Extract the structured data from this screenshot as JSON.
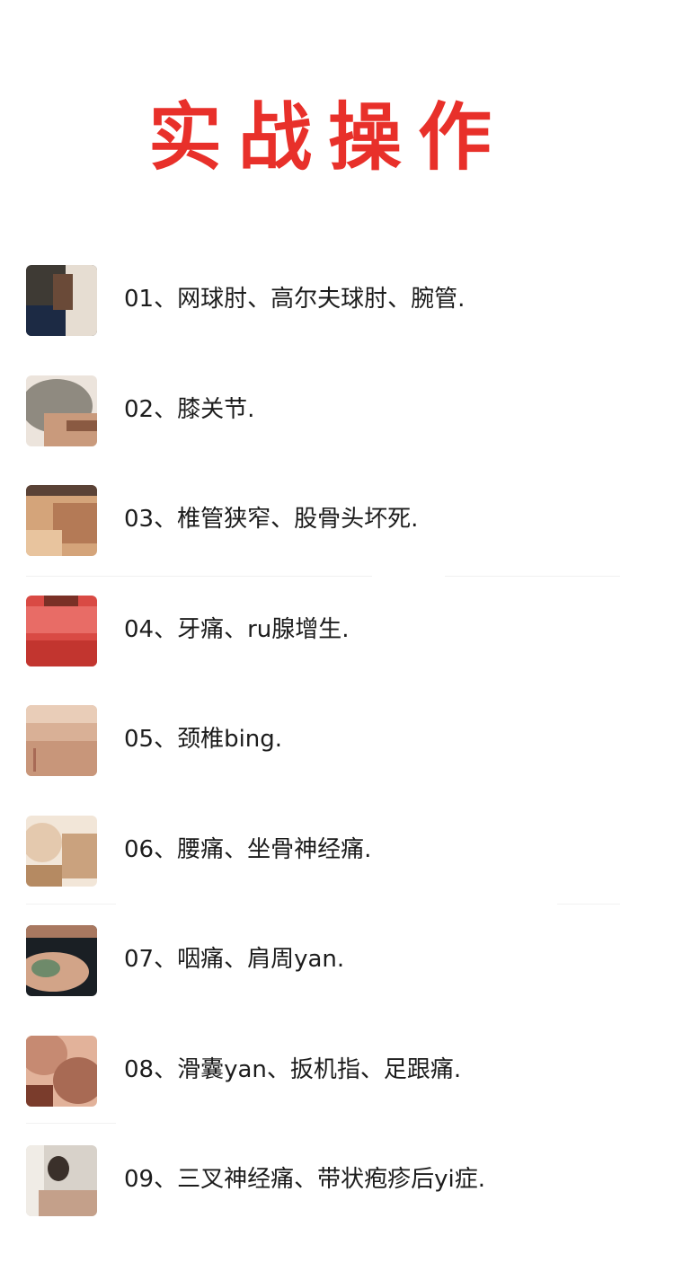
{
  "title": "实战操作",
  "items": [
    {
      "label": "01、网球肘、高尔夫球肘、腕管.",
      "thumb_colors": [
        "#3e3a34",
        "#6a4a38",
        "#1c2a44",
        "#e6ddd2"
      ]
    },
    {
      "label": "02、膝关节.",
      "thumb_colors": [
        "#8f8a80",
        "#c99a7c",
        "#8a5a42",
        "#ece4dc"
      ]
    },
    {
      "label": "03、椎管狭窄、股骨头坏死.",
      "thumb_colors": [
        "#d4a47a",
        "#b47a56",
        "#5a4236",
        "#e8c49e"
      ]
    },
    {
      "label": "04、牙痛、ru腺增生.",
      "thumb_colors": [
        "#d94a44",
        "#c2352f",
        "#7a3026",
        "#e86c66"
      ]
    },
    {
      "label": "05、颈椎bing.",
      "thumb_colors": [
        "#d9b096",
        "#c8967a",
        "#a86a56",
        "#e9cdb8"
      ]
    },
    {
      "label": "06、腰痛、坐骨神经痛.",
      "thumb_colors": [
        "#e4c9ae",
        "#caa27e",
        "#f2e6d8",
        "#b58a62"
      ]
    },
    {
      "label": "07、咽痛、肩周yan.",
      "thumb_colors": [
        "#1a1f24",
        "#a87860",
        "#6e8a6a",
        "#d2a488"
      ]
    },
    {
      "label": "08、滑囊yan、扳机指、足跟痛.",
      "thumb_colors": [
        "#a86a54",
        "#c68a72",
        "#7a3c2c",
        "#e2b29a"
      ]
    },
    {
      "label": "09、三叉神经痛、带状疱疹后yi症.",
      "thumb_colors": [
        "#d8d2ca",
        "#3a302a",
        "#c4a08a",
        "#f0ece6"
      ]
    }
  ]
}
